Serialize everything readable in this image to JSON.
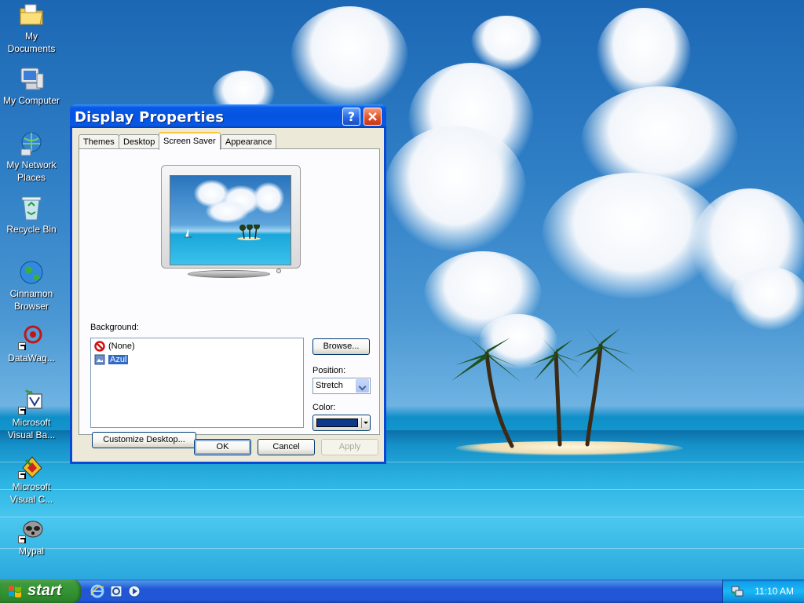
{
  "desktop": {
    "icons": [
      {
        "label": "My Documents"
      },
      {
        "label": "My Computer"
      },
      {
        "label": "My Network Places"
      },
      {
        "label": "Recycle Bin"
      },
      {
        "label": "Cinnamon Browser"
      },
      {
        "label": "DataWag..."
      },
      {
        "label": "Microsoft Visual Ba..."
      },
      {
        "label": "Microsoft Visual C..."
      },
      {
        "label": "Mypal"
      }
    ]
  },
  "dialog": {
    "title": "Display Properties",
    "help_button": "?",
    "tabs": [
      {
        "label": "Themes"
      },
      {
        "label": "Desktop"
      },
      {
        "label": "Screen Saver",
        "active": true
      },
      {
        "label": "Appearance"
      }
    ],
    "background_label": "Background:",
    "background_items": [
      {
        "label": "(None)",
        "icon": "no-symbol-icon"
      },
      {
        "label": "Azul",
        "icon": "image-file-icon",
        "selected": true
      }
    ],
    "browse_button": "Browse...",
    "position_label": "Position:",
    "position_value": "Stretch",
    "color_label": "Color:",
    "color_value": "#0a3a8e",
    "customize_button": "Customize Desktop...",
    "ok_button": "OK",
    "cancel_button": "Cancel",
    "apply_button": "Apply"
  },
  "taskbar": {
    "start_label": "start",
    "quick_launch": [
      {
        "icon": "internet-explorer-icon"
      },
      {
        "icon": "outlook-express-icon"
      },
      {
        "icon": "media-player-icon"
      }
    ],
    "tray_icon": "network-tray-icon",
    "clock": "11:10 AM"
  },
  "colors": {
    "title_bar": "#0a5ae8",
    "dialog_face": "#ece9d8",
    "selection": "#316ac5",
    "start_green": "#31912f",
    "taskbar_blue": "#2157d7"
  }
}
